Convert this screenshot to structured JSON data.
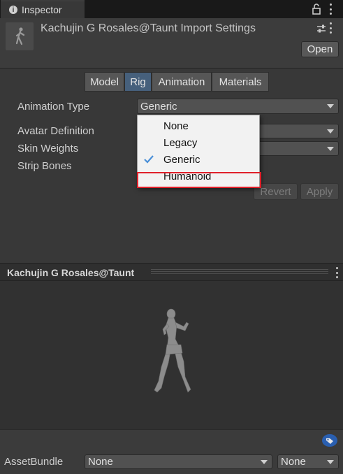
{
  "window": {
    "tab_title": "Inspector"
  },
  "header": {
    "title": "Kachujin G Rosales@Taunt Import Settings",
    "open_label": "Open"
  },
  "tabs": [
    {
      "label": "Model"
    },
    {
      "label": "Rig",
      "active": true
    },
    {
      "label": "Animation"
    },
    {
      "label": "Materials"
    }
  ],
  "rig": {
    "animation_type_label": "Animation Type",
    "animation_type_value": "Generic",
    "avatar_definition_label": "Avatar Definition",
    "skin_weights_label": "Skin Weights",
    "strip_bones_label": "Strip Bones",
    "revert_label": "Revert",
    "apply_label": "Apply"
  },
  "popup_menu": {
    "items": [
      {
        "label": "None",
        "checked": false
      },
      {
        "label": "Legacy",
        "checked": false
      },
      {
        "label": "Generic",
        "checked": true
      },
      {
        "label": "Humanoid",
        "checked": false
      }
    ]
  },
  "preview": {
    "title": "Kachujin G Rosales@Taunt"
  },
  "asset_bundle": {
    "label": "AssetBundle",
    "name_value": "None",
    "variant_value": "None"
  },
  "colors": {
    "active_tab": "#46607c",
    "highlight": "#e0202a",
    "checkmark": "#4a8fd8",
    "tag_icon": "#2a5fb0"
  }
}
